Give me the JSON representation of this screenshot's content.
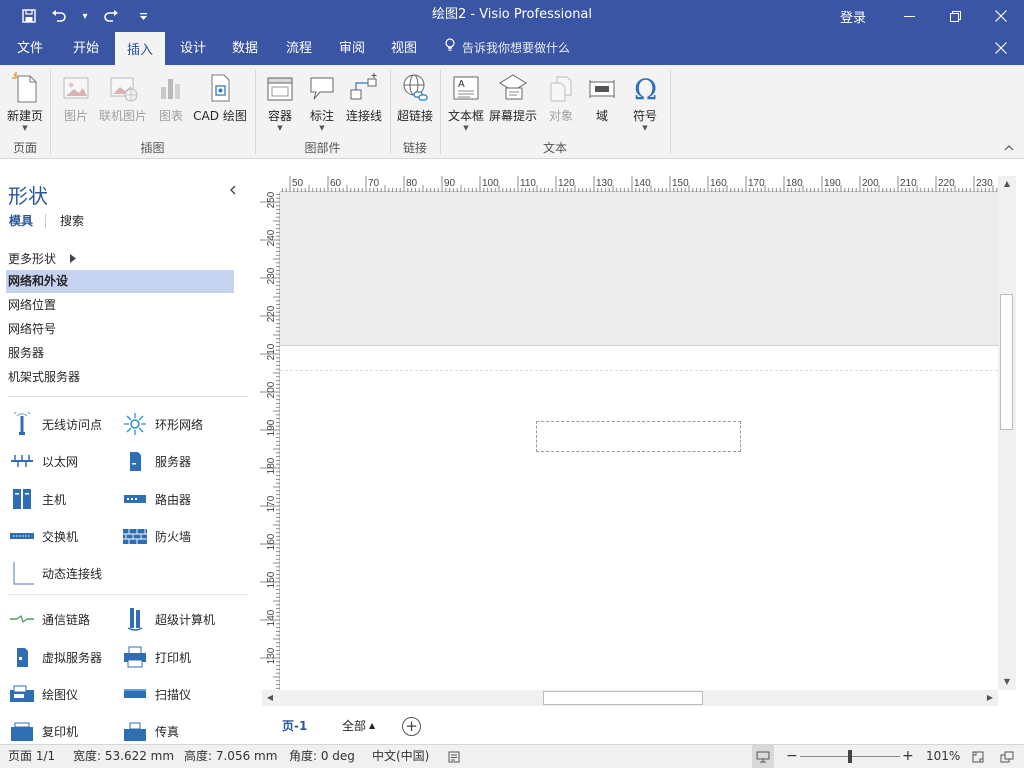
{
  "titlebar": {
    "title": "绘图2 - Visio Professional",
    "sign_in": "登录",
    "qat": [
      "save-icon",
      "undo-icon",
      "redo-icon",
      "customize-icon"
    ]
  },
  "tabs": [
    "文件",
    "开始",
    "插入",
    "设计",
    "数据",
    "流程",
    "审阅",
    "视图"
  ],
  "active_tab": "插入",
  "tell_me": "告诉我你想要做什么",
  "ribbon": {
    "buttons": {
      "new_page": "新建页",
      "picture": "图片",
      "online_picture": "联机图片",
      "chart": "图表",
      "cad": "CAD 绘图",
      "container": "容器",
      "callout": "标注",
      "connector": "连接线",
      "hyperlink": "超链接",
      "textbox": "文本框",
      "screentip": "屏幕提示",
      "object": "对象",
      "field": "域",
      "symbol": "符号"
    },
    "groups": {
      "pages": "页面",
      "illustrations": "插图",
      "diagram_parts": "图部件",
      "links": "链接",
      "text": "文本"
    }
  },
  "shapes_pane": {
    "title": "形状",
    "tab_stencils": "模具",
    "tab_search": "搜索",
    "more_shapes": "更多形状",
    "stencils": [
      "网络和外设",
      "网络位置",
      "网络符号",
      "服务器",
      "机架式服务器"
    ],
    "selected_stencil": "网络和外设",
    "shapes": {
      "wireless": "无线访问点",
      "ring": "环形网络",
      "ethernet": "以太网",
      "server": "服务器",
      "mainframe": "主机",
      "router": "路由器",
      "switch": "交换机",
      "firewall": "防火墙",
      "dynamic_connector": "动态连接线",
      "comm_link": "通信链路",
      "supercomputer": "超级计算机",
      "virtual_server": "虚拟服务器",
      "printer": "打印机",
      "plotter": "绘图仪",
      "scanner": "扫描仪",
      "copier": "复印机",
      "fax": "传真"
    }
  },
  "rulers": {
    "horizontal": [
      "50",
      "60",
      "70",
      "80",
      "90",
      "100",
      "110",
      "120",
      "130",
      "140",
      "150",
      "160",
      "170",
      "180",
      "190",
      "200",
      "210",
      "220",
      "230"
    ],
    "vertical": [
      "250",
      "240",
      "230",
      "220",
      "210",
      "200",
      "190",
      "180",
      "170",
      "160",
      "150",
      "140",
      "130"
    ]
  },
  "page_tabs": {
    "page": "页-1",
    "all": "全部"
  },
  "status": {
    "page": "页面 1/1",
    "width": "宽度: 53.622 mm",
    "height": "高度: 7.056 mm",
    "angle": "角度: 0 deg",
    "language": "中文(中国)",
    "zoom": "101%"
  },
  "colors": {
    "titlebar": "#3955a3",
    "accent": "#2b579a",
    "selected_stencil": "#c5d2f0"
  }
}
